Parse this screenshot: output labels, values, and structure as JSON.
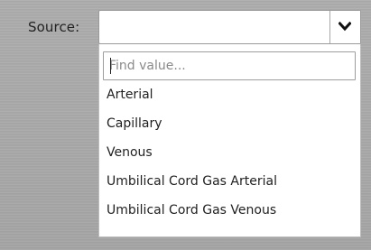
{
  "field": {
    "label": "Source:",
    "value": ""
  },
  "dropdown": {
    "search_placeholder": "Find value...",
    "search_value": "",
    "options": [
      "Arterial",
      "Capillary",
      "Venous",
      "Umbilical Cord Gas Arterial",
      "Umbilical Cord Gas Venous"
    ]
  },
  "icons": {
    "arrow": "chevron-down-icon"
  },
  "colors": {
    "background": "#a7a7a7",
    "field_bg": "#ffffff",
    "border": "#9a9a9a",
    "text": "#222222",
    "placeholder": "#8a8a8a"
  }
}
